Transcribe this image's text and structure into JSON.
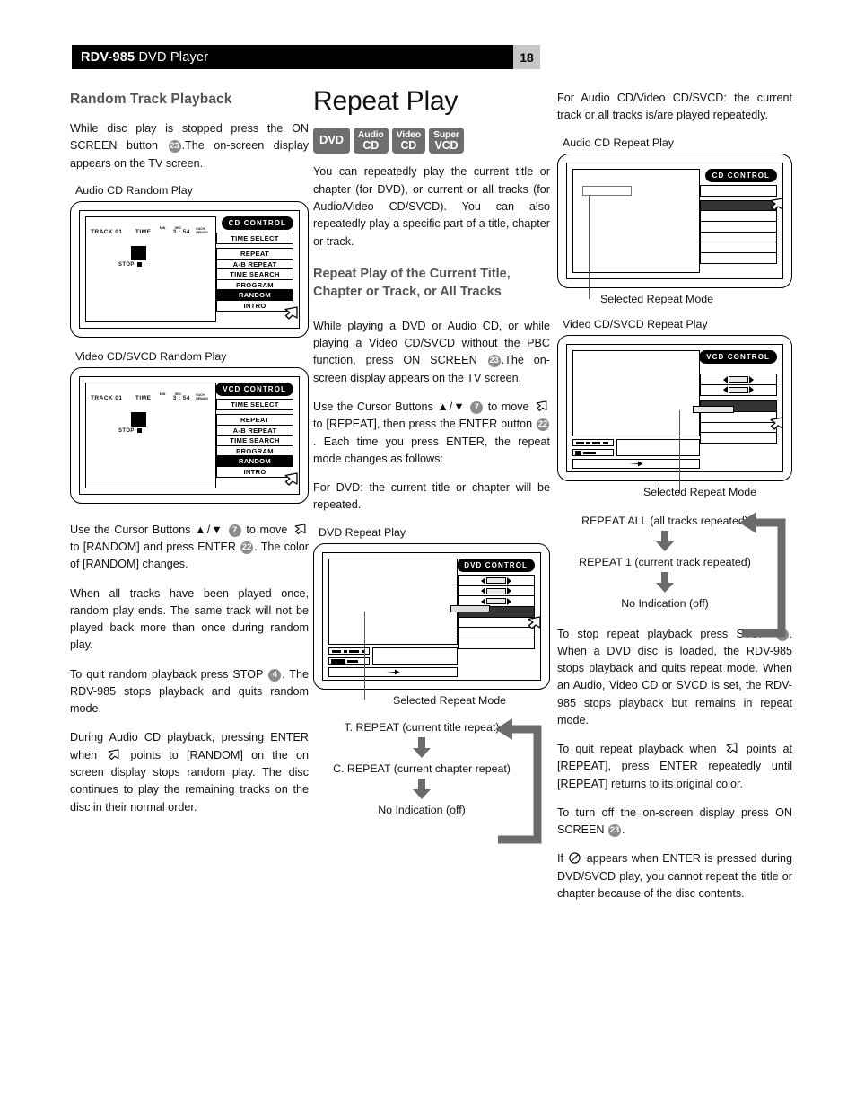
{
  "header": {
    "model": "RDV-985",
    "product": " DVD Player",
    "page_number": "18"
  },
  "col1": {
    "heading": "Random Track Playback",
    "p1_a": "While disc play is stopped press the ON SCREEN button ",
    "p1_badge": "23",
    "p1_b": ".The on-screen display appears on the TV screen.",
    "caption_cd": "Audio CD Random Play",
    "caption_vcd": "Video CD/SVCD Random Play",
    "p2_a": "Use the Cursor Buttons ▲/▼ ",
    "p2_b1": "7",
    "p2_c": " to move ",
    "p2_d": " to [RANDOM] and press ENTER ",
    "p2_b2": "22",
    "p2_e": ". The color of [RANDOM] changes.",
    "p3": "When all tracks have been played once, random play ends. The same track will not be played back more than once during random play.",
    "p4_a": "To quit random playback press    STOP ",
    "p4_b": "4",
    "p4_c": ". The RDV-985 stops playback and quits random mode.",
    "p5_a": "During Audio CD playback, pressing ENTER when ",
    "p5_b": " points to [RANDOM] on the on screen display stops random play. The disc continues to play the remaining tracks on the disc in their normal order."
  },
  "col2": {
    "title": "Repeat Play",
    "badges": [
      {
        "type": "one",
        "text": "DVD"
      },
      {
        "type": "two",
        "l1": "Audio",
        "l2": "CD"
      },
      {
        "type": "two",
        "l1": "Video",
        "l2": "CD"
      },
      {
        "type": "two",
        "l1": "Super",
        "l2": "VCD"
      }
    ],
    "p1": "You can repeatedly play the current title or chapter (for DVD), or current or all tracks (for Audio/Video CD/SVCD). You can also repeatedly play a specific part of a title, chapter or track.",
    "subheading": "Repeat Play of the Current Title, Chapter or Track, or All Tracks",
    "p2_a": "While playing a DVD or Audio CD, or while playing a Video CD/SVCD without the PBC function, press ON SCREEN ",
    "p2_badge": "23",
    "p2_b": ".The on-screen display appears on the TV screen.",
    "p3_a": "Use the Cursor Buttons ▲/▼ ",
    "p3_b1": "7",
    "p3_c": " to move ",
    "p3_d": " to [REPEAT], then press the ENTER button ",
    "p3_b2": "22",
    "p3_e": ". Each time you press ENTER, the repeat mode changes as follows:",
    "p4": "For DVD: the current title or chapter will be repeated.",
    "caption_dvd": "DVD Repeat Play",
    "label_selected": "Selected Repeat Mode",
    "flow": [
      "T. REPEAT (current title repeat)",
      "C. REPEAT (current chapter repeat)",
      "No Indication (off)"
    ]
  },
  "col3": {
    "p1": "For Audio CD/Video CD/SVCD: the current track or all tracks is/are played repeatedly.",
    "caption_cd": "Audio CD Repeat Play",
    "label_selected_cd": "Selected Repeat Mode",
    "caption_vcd": "Video CD/SVCD Repeat Play",
    "label_selected_vcd": "Selected Repeat Mode",
    "flow": [
      "REPEAT ALL (all tracks repeated)",
      "REPEAT 1 (current track repeated)",
      "No Indication (off)"
    ],
    "p2_a": "To stop repeat playback press    STOP ",
    "p2_b": "4",
    "p2_c": ". When a DVD disc is loaded, the RDV-985 stops playback and quits repeat mode. When an Audio, Video CD or SVCD is set, the RDV-985 stops playback but remains in repeat mode.",
    "p3_a": "To quit repeat playback when ",
    "p3_b": " points at [REPEAT], press ENTER repeatedly until [REPEAT] returns to its original color.",
    "p4_a": "To turn off the on-screen display press ON SCREEN ",
    "p4_b": "23",
    "p4_c": ".",
    "p5_a": "If ",
    "p5_b": " appears when ENTER is pressed during DVD/SVCD play, you cannot repeat the title or chapter because of the disc contents."
  },
  "osd": {
    "cd_control_label": "CD CONTROL",
    "vcd_control_label": "VCD CONTROL",
    "dvd_control_label": "DVD CONTROL",
    "track_label": "TRACK 01",
    "time_label": "TIME",
    "min_label": "MIN",
    "sec_label": "SEC",
    "time_value": "3 : 54",
    "each_remain": "EACH REMAIN",
    "stop_label": "STOP",
    "menu_items": [
      "TIME SELECT",
      "REPEAT",
      "A-B REPEAT",
      "TIME SEARCH",
      "PROGRAM",
      "RANDOM",
      "INTRO"
    ],
    "selected_random": "RANDOM"
  }
}
